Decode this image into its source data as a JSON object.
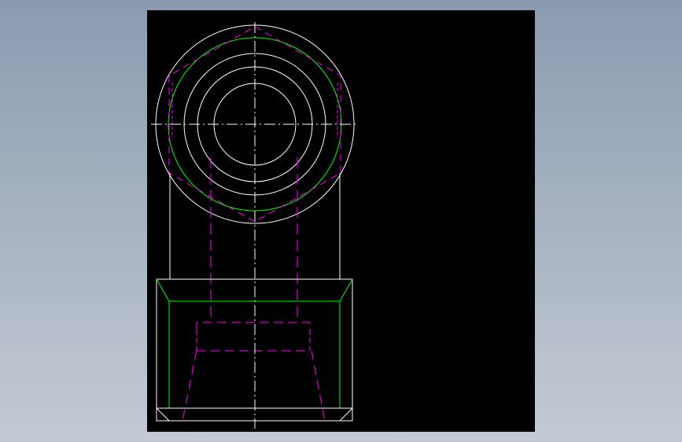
{
  "colors": {
    "background_top": "#8a9bb1",
    "background_bottom": "#c4cad3",
    "canvas": "#000000",
    "outline": "#ffffff",
    "visible_edge": "#00ff00",
    "hidden_line": "#ff00ff",
    "center_line": "#ffffff"
  },
  "line_types": {
    "outline": "continuous",
    "hidden_line": "dashed",
    "center_line": "dash-dot"
  }
}
